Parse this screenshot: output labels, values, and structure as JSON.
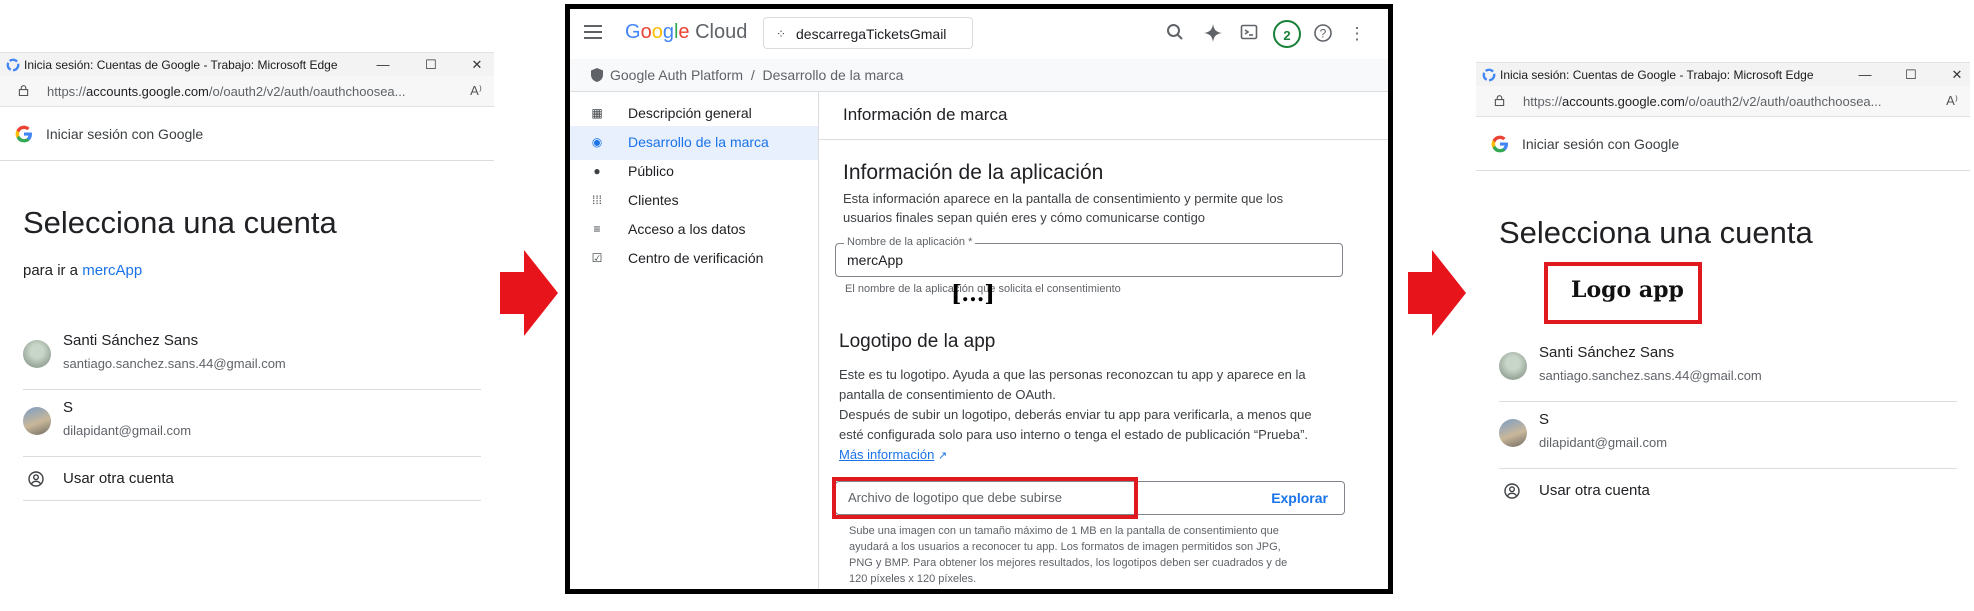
{
  "window_left": {
    "title": "Inicia sesión: Cuentas de Google - Trabajo: Microsoft Edge",
    "url_prefix": "https://",
    "url_host": "accounts.google.com",
    "url_rest": "/o/oauth2/v2/auth/oauthchoosea...",
    "google_bar": "Iniciar sesión con Google",
    "heading": "Selecciona una cuenta",
    "continue_prefix": "para ir a ",
    "app_name": "mercApp",
    "accounts": [
      {
        "name": "Santi Sánchez Sans",
        "email": "santiago.sanchez.sans.44@gmail.com"
      },
      {
        "name": "S",
        "email": "dilapidant@gmail.com"
      }
    ],
    "other_account": "Usar otra cuenta"
  },
  "console": {
    "brand": "Google Cloud",
    "project": "descarregaTicketsGmail",
    "badge": "2",
    "breadcrumb": "Google Auth Platform  /  Desarrollo de la marca",
    "sidebar": [
      {
        "label": "Descripción general",
        "icon": "dashboard-icon"
      },
      {
        "label": "Desarrollo de la marca",
        "icon": "palette-icon"
      },
      {
        "label": "Público",
        "icon": "person-icon"
      },
      {
        "label": "Clientes",
        "icon": "grid-icon"
      },
      {
        "label": "Acceso a los datos",
        "icon": "data-access-icon"
      },
      {
        "label": "Centro de verificación",
        "icon": "checkbox-icon"
      }
    ],
    "section_title": "Información de marca",
    "app_info_heading": "Información de la aplicación",
    "app_info_desc_1": "Esta información aparece en la pantalla de consentimiento y permite que los",
    "app_info_desc_2": "usuarios finales sepan quién eres y cómo comunicarse contigo",
    "app_name_label": "Nombre de la aplicación *",
    "app_name_value": "mercApp",
    "app_name_hint": "El nombre de la aplicación que solicita el consentimiento",
    "ellipsis": "[...]",
    "logo_heading": "Logotipo de la app",
    "logo_desc_1": "Este es tu logotipo. Ayuda a que las personas reconozcan tu app y aparece en la",
    "logo_desc_2": "pantalla de consentimiento de OAuth.",
    "logo_desc_3": "Después de subir un logotipo, deberás enviar tu app para verificarla, a menos que",
    "logo_desc_4": "esté configurada solo para uso interno o tenga el estado de publicación “Prueba”.",
    "more_info": "Más información",
    "upload_placeholder": "Archivo de logotipo que debe subirse",
    "upload_button": "Explorar",
    "upload_help_1": "Sube una imagen con un tamaño máximo de 1 MB en la pantalla de consentimiento que",
    "upload_help_2": "ayudará a los usuarios a reconocer tu app. Los formatos de imagen permitidos son JPG,",
    "upload_help_3": "PNG y BMP. Para obtener los mejores resultados, los logotipos deben ser cuadrados y de",
    "upload_help_4": "120 píxeles x 120 píxeles."
  },
  "window_right": {
    "title": "Inicia sesión: Cuentas de Google - Trabajo: Microsoft Edge",
    "url_prefix": "https://",
    "url_host": "accounts.google.com",
    "url_rest": "/o/oauth2/v2/auth/oauthchoosea...",
    "google_bar": "Iniciar sesión con Google",
    "heading": "Selecciona una cuenta",
    "logo_placeholder": "Logo app",
    "accounts": [
      {
        "name": "Santi Sánchez Sans",
        "email": "santiago.sanchez.sans.44@gmail.com"
      },
      {
        "name": "S",
        "email": "dilapidant@gmail.com"
      }
    ],
    "other_account": "Usar otra cuenta"
  },
  "colors": {
    "accent_blue": "#1a73e8",
    "highlight_red": "#e0191f",
    "arrow_red": "#e8141c",
    "active_nav_bg": "#e8f0fe"
  }
}
